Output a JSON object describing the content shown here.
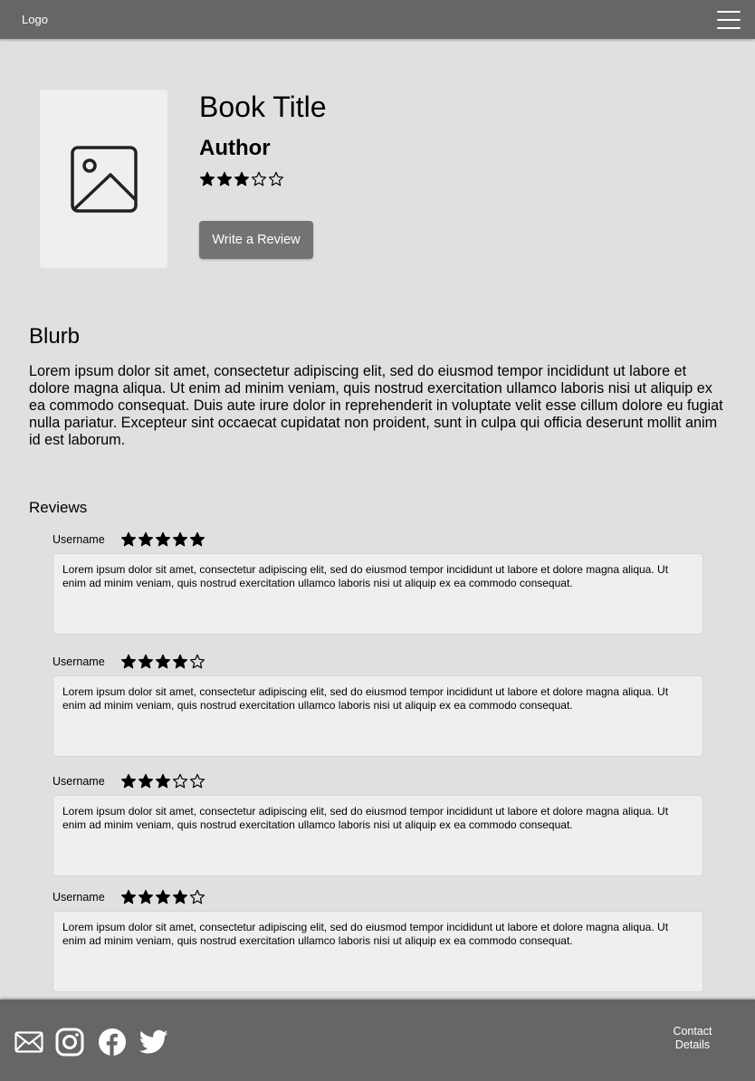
{
  "navbar": {
    "logo": "Logo",
    "menu_icon": "hamburger-menu-icon"
  },
  "book": {
    "cover_icon": "image-placeholder-icon",
    "title": "Book Title",
    "author": "Author",
    "rating": 3,
    "rating_max": 5,
    "write_review_label": "Write a Review"
  },
  "blurb": {
    "heading": "Blurb",
    "text": "Lorem ipsum dolor sit amet, consectetur adipiscing elit, sed do eiusmod tempor incididunt ut labore et dolore magna aliqua. Ut enim ad minim veniam, quis nostrud exercitation ullamco laboris nisi ut aliquip ex ea commodo consequat. Duis aute irure dolor in reprehenderit in voluptate velit esse cillum dolore eu fugiat nulla pariatur. Excepteur sint occaecat cupidatat non proident, sunt in culpa qui officia deserunt mollit anim id est laborum."
  },
  "reviews": {
    "heading": "Reviews",
    "items": [
      {
        "username": "Username",
        "rating": 5,
        "text": "Lorem ipsum dolor sit amet, consectetur adipiscing elit, sed do eiusmod tempor incididunt ut labore et dolore magna aliqua. Ut enim ad minim veniam, quis nostrud exercitation ullamco laboris nisi ut aliquip ex ea commodo consequat."
      },
      {
        "username": "Username",
        "rating": 4,
        "text": "Lorem ipsum dolor sit amet, consectetur adipiscing elit, sed do eiusmod tempor incididunt ut labore et dolore magna aliqua. Ut enim ad minim veniam, quis nostrud exercitation ullamco laboris nisi ut aliquip ex ea commodo consequat."
      },
      {
        "username": "Username",
        "rating": 3,
        "text": "Lorem ipsum dolor sit amet, consectetur adipiscing elit, sed do eiusmod tempor incididunt ut labore et dolore magna aliqua. Ut enim ad minim veniam, quis nostrud exercitation ullamco laboris nisi ut aliquip ex ea commodo consequat."
      },
      {
        "username": "Username",
        "rating": 4,
        "text": "Lorem ipsum dolor sit amet, consectetur adipiscing elit, sed do eiusmod tempor incididunt ut labore et dolore magna aliqua. Ut enim ad minim veniam, quis nostrud exercitation ullamco laboris nisi ut aliquip ex ea commodo consequat."
      }
    ]
  },
  "footer": {
    "social_icons": [
      "email-icon",
      "instagram-icon",
      "facebook-icon",
      "twitter-icon"
    ],
    "contact_label": "Contact Details"
  },
  "colors": {
    "bar": "#666666",
    "page": "#e0e0e0",
    "card": "#efefef",
    "button": "#737373"
  }
}
